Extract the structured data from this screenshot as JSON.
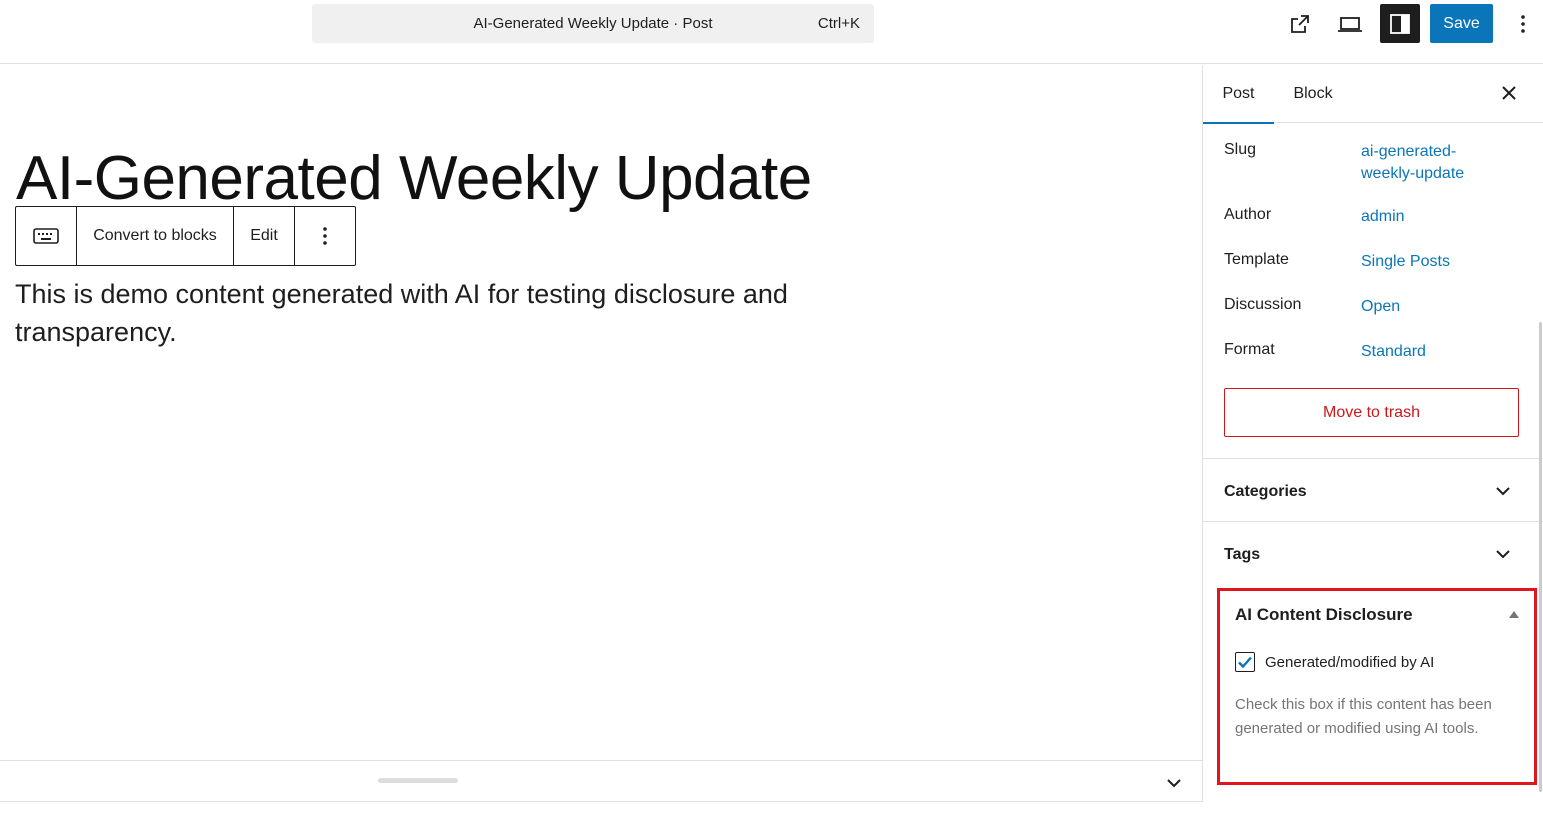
{
  "header": {
    "command_bar_title": "AI-Generated Weekly Update · Post",
    "command_bar_shortcut": "Ctrl+K",
    "save_label": "Save",
    "icons": [
      "external-link-icon",
      "desktop-preview-icon",
      "sidebar-toggle-icon",
      "more-vertical-icon"
    ]
  },
  "editor": {
    "title": "AI-Generated Weekly Update",
    "block_toolbar": {
      "convert_label": "Convert to blocks",
      "edit_label": "Edit"
    },
    "paragraph": "This is demo content generated with AI for testing disclosure and transparency."
  },
  "sidebar": {
    "tabs": [
      {
        "label": "Post",
        "active": true
      },
      {
        "label": "Block",
        "active": false
      }
    ],
    "summary": [
      {
        "label": "Slug",
        "value": "ai-generated-weekly-update",
        "value_line1": "ai-generated-",
        "value_line2": "weekly-update"
      },
      {
        "label": "Author",
        "value": "admin"
      },
      {
        "label": "Template",
        "value": "Single Posts"
      },
      {
        "label": "Discussion",
        "value": "Open"
      },
      {
        "label": "Format",
        "value": "Standard"
      }
    ],
    "trash_label": "Move to trash",
    "panels": [
      {
        "title": "Categories",
        "expanded": false
      },
      {
        "title": "Tags",
        "expanded": false
      }
    ],
    "ai_disclosure": {
      "title": "AI Content Disclosure",
      "expanded": true,
      "checkbox_label": "Generated/modified by AI",
      "checked": true,
      "help_text": "Check this box if this content has been generated or modified using AI tools."
    }
  },
  "colors": {
    "accent": "#0a75b9",
    "danger": "#cc1818",
    "highlight_border": "#e3141e"
  }
}
